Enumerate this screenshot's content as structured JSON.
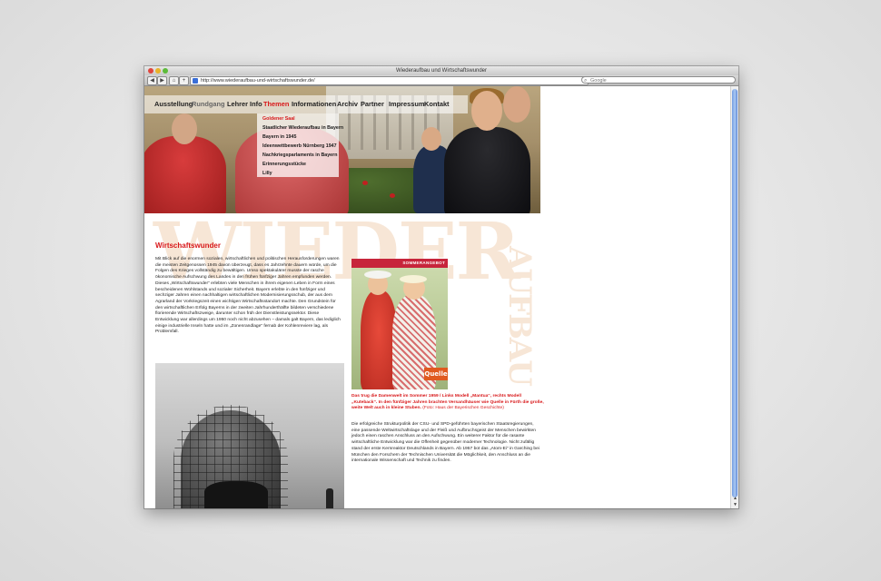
{
  "window": {
    "title": "Wiederaufbau und Wirtschaftswunder"
  },
  "toolbar": {
    "back_icon": "back-arrow-icon",
    "forward_icon": "forward-arrow-icon",
    "home_icon": "home-icon",
    "add_icon": "plus-icon",
    "url": "http://www.wiederaufbau-und-wirtschaftswunder.de/",
    "search_placeholder": "Google"
  },
  "nav": {
    "items": [
      "Ausstellung",
      "Rundgang",
      "Lehrer Info",
      "Themen",
      "Informationen",
      "Archiv",
      "Partner",
      "Impressum",
      "Kontakt"
    ],
    "active": "Themen"
  },
  "submenu": {
    "items": [
      "Goldener Saal",
      "Staatlicher Wiederaufbau in Bayern",
      "Bayern in 1945",
      "Ideenwettbewerb Nürnberg 1947",
      "Nachkriegsparlaments in Bayern",
      "Erinnerungsstücke",
      "Lilly"
    ]
  },
  "watermark": {
    "line1": "WIEDER",
    "line2": "AUFBAU"
  },
  "article": {
    "title": "Wirtschaftswunder",
    "paragraph1": "Mit Blick auf die enormen sozialen, wirtschaftlichen und politischen Herausforderungen waren die meisten Zeitgenossen 1945 davon überzeugt, dass es Jahrzehnte dauern würde, um die Folgen des Krieges vollständig zu bewältigen. Umso spektakulärer musste der rasche ökonomische Aufschwung des Landes in den frühen fünfziger Jahren empfunden werden. Dieses „Wirtschaftswunder“ erlebten viele Menschen in ihrem eigenen Leben in Form eines bescheidenen Wohlstands und sozialer Sicherheit. Bayern erlebte in den fünfziger und sechziger Jahren einen nachhaltigen wirtschaftlichen Modernisierungsschub, der aus dem Agrarland der Vorkriegszeit einen wichtigen Wirtschaftsstandort machte. Den Grundstein für den wirtschaftlichen Erfolg Bayerns in der zweiten Jahrhunderthälfte bildeten verschiedene florierende Wirtschaftszweige, darunter schon früh der Dienstleistungssektor. Diese Entwicklung war allerdings um 1950 noch nicht abzusehen – damals galt Bayern, das lediglich einige industrielle Inseln hatte und im „Zonenrandlage“ fernab der Kohlenreviere lag, als Problemfall.",
    "caption": "Das trug die Damenwelt im Sommer 1959 / Links Modell „Mantua“, rechts Modell „Kuteback“. In den fünfziger Jahren brachten Versandhäuser wie Quelle in Fürth die große, weite Welt auch in kleine Stuben.",
    "caption_source": "(Foto: Haus der Bayerischen Geschichte)",
    "paragraph2": "Die erfolgreiche Strukturpolitik der CSU- und SPD-geführten bayerischen Staatsregierungen, eine passende Weltwirtschaftslage und der Fleiß und Aufbruchsgeist der Menschen bewirkten jedoch einen raschen Anschluss an den Aufschwung. Ein weiterer Faktor für die rasante wirtschaftliche Entwicklung war die Offenheit gegenüber moderner Technologie. Nicht zufällig stand der erste Kernreaktor Deutschlands in Bayern. Ab 1957 bot das „Atom-Ei“ in Garching bei München den Forschern der Technischen Universität die Möglichkeit, den Anschluss an die internationale Wissenschaft und Technik zu finden.",
    "quelle_banner": "SOMMERANGEBOT",
    "quelle_logo": "Quelle"
  },
  "colors": {
    "accent": "#d8181a",
    "watermark": "#f7e6d6",
    "scroll": "#6f9be0"
  }
}
